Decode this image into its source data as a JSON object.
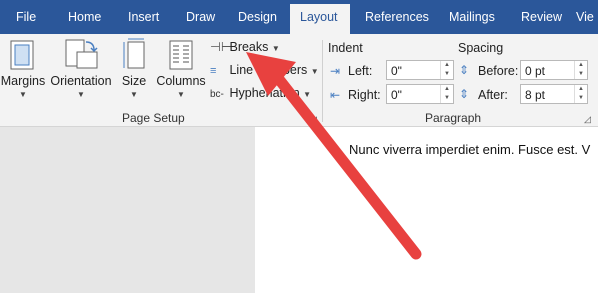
{
  "tabs": [
    {
      "label": "File"
    },
    {
      "label": "Home"
    },
    {
      "label": "Insert"
    },
    {
      "label": "Draw"
    },
    {
      "label": "Design"
    },
    {
      "label": "Layout",
      "active": true
    },
    {
      "label": "References"
    },
    {
      "label": "Mailings"
    },
    {
      "label": "Review"
    },
    {
      "label": "Vie"
    }
  ],
  "page_setup": {
    "margins_label": "Margins",
    "orientation_label": "Orientation",
    "size_label": "Size",
    "columns_label": "Columns",
    "breaks_label": "Breaks",
    "line_numbers_label": "Line Numbers",
    "hyphenation_label": "Hyphenation",
    "group_label": "Page Setup"
  },
  "paragraph": {
    "indent_title": "Indent",
    "spacing_title": "Spacing",
    "left_label": "Left:",
    "left_value": "0\"",
    "right_label": "Right:",
    "right_value": "0\"",
    "before_label": "Before:",
    "before_value": "0 pt",
    "after_label": "After:",
    "after_value": "8 pt",
    "group_label": "Paragraph"
  },
  "document": {
    "line_text": "Nunc viverra imperdiet enim. Fusce est. V"
  },
  "colors": {
    "title_bar": "#2b579a",
    "annotation_arrow": "#e8413f"
  }
}
